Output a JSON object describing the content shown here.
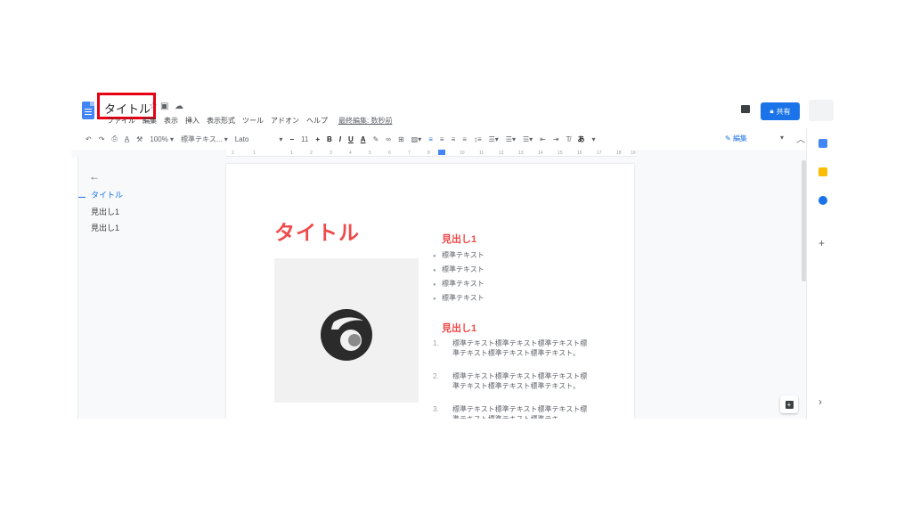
{
  "header": {
    "title": "タイトル",
    "star_icon": "☆",
    "menu": [
      "ファイル",
      "編集",
      "表示",
      "挿入",
      "表示形式",
      "ツール",
      "アドオン",
      "ヘルプ"
    ],
    "last_edit": "最終編集: 数秒前",
    "share_label": "共有"
  },
  "toolbar": {
    "zoom": "100%",
    "style": "標準テキス...",
    "font": "Lato",
    "font_size": "11",
    "minus": "−",
    "plus": "+",
    "bold": "B",
    "italic": "I",
    "underline": "U",
    "text_color": "A",
    "input_tool": "あ",
    "edit_mode": "編集"
  },
  "ruler_ticks": [
    "2",
    "1",
    "1",
    "2",
    "3",
    "4",
    "5",
    "6",
    "7",
    "8",
    "10",
    "11",
    "12",
    "13",
    "14",
    "15",
    "16",
    "17",
    "18",
    "19"
  ],
  "outline": {
    "items": [
      "タイトル",
      "見出し1",
      "見出し1"
    ]
  },
  "document": {
    "title": "タイトル",
    "section1": {
      "heading": "見出し1",
      "bullets": [
        "標準テキスト",
        "標準テキスト",
        "標準テキスト",
        "標準テキスト"
      ]
    },
    "section2": {
      "heading": "見出し1",
      "items": [
        {
          "num": "1.",
          "text": "標準テキスト標準テキスト標準テキスト標準テキスト標準テキスト標準テキスト。"
        },
        {
          "num": "2.",
          "text": "標準テキスト標準テキスト標準テキスト標準テキスト標準テキスト標準テキスト。"
        },
        {
          "num": "3.",
          "text": "標準テキスト標準テキスト標準テキスト標準テキスト標準テキスト標準テキ"
        }
      ]
    }
  },
  "colors": {
    "accent": "#1a73e8",
    "heading_red": "#ef4a4a",
    "highlight_box": "#e60012"
  }
}
